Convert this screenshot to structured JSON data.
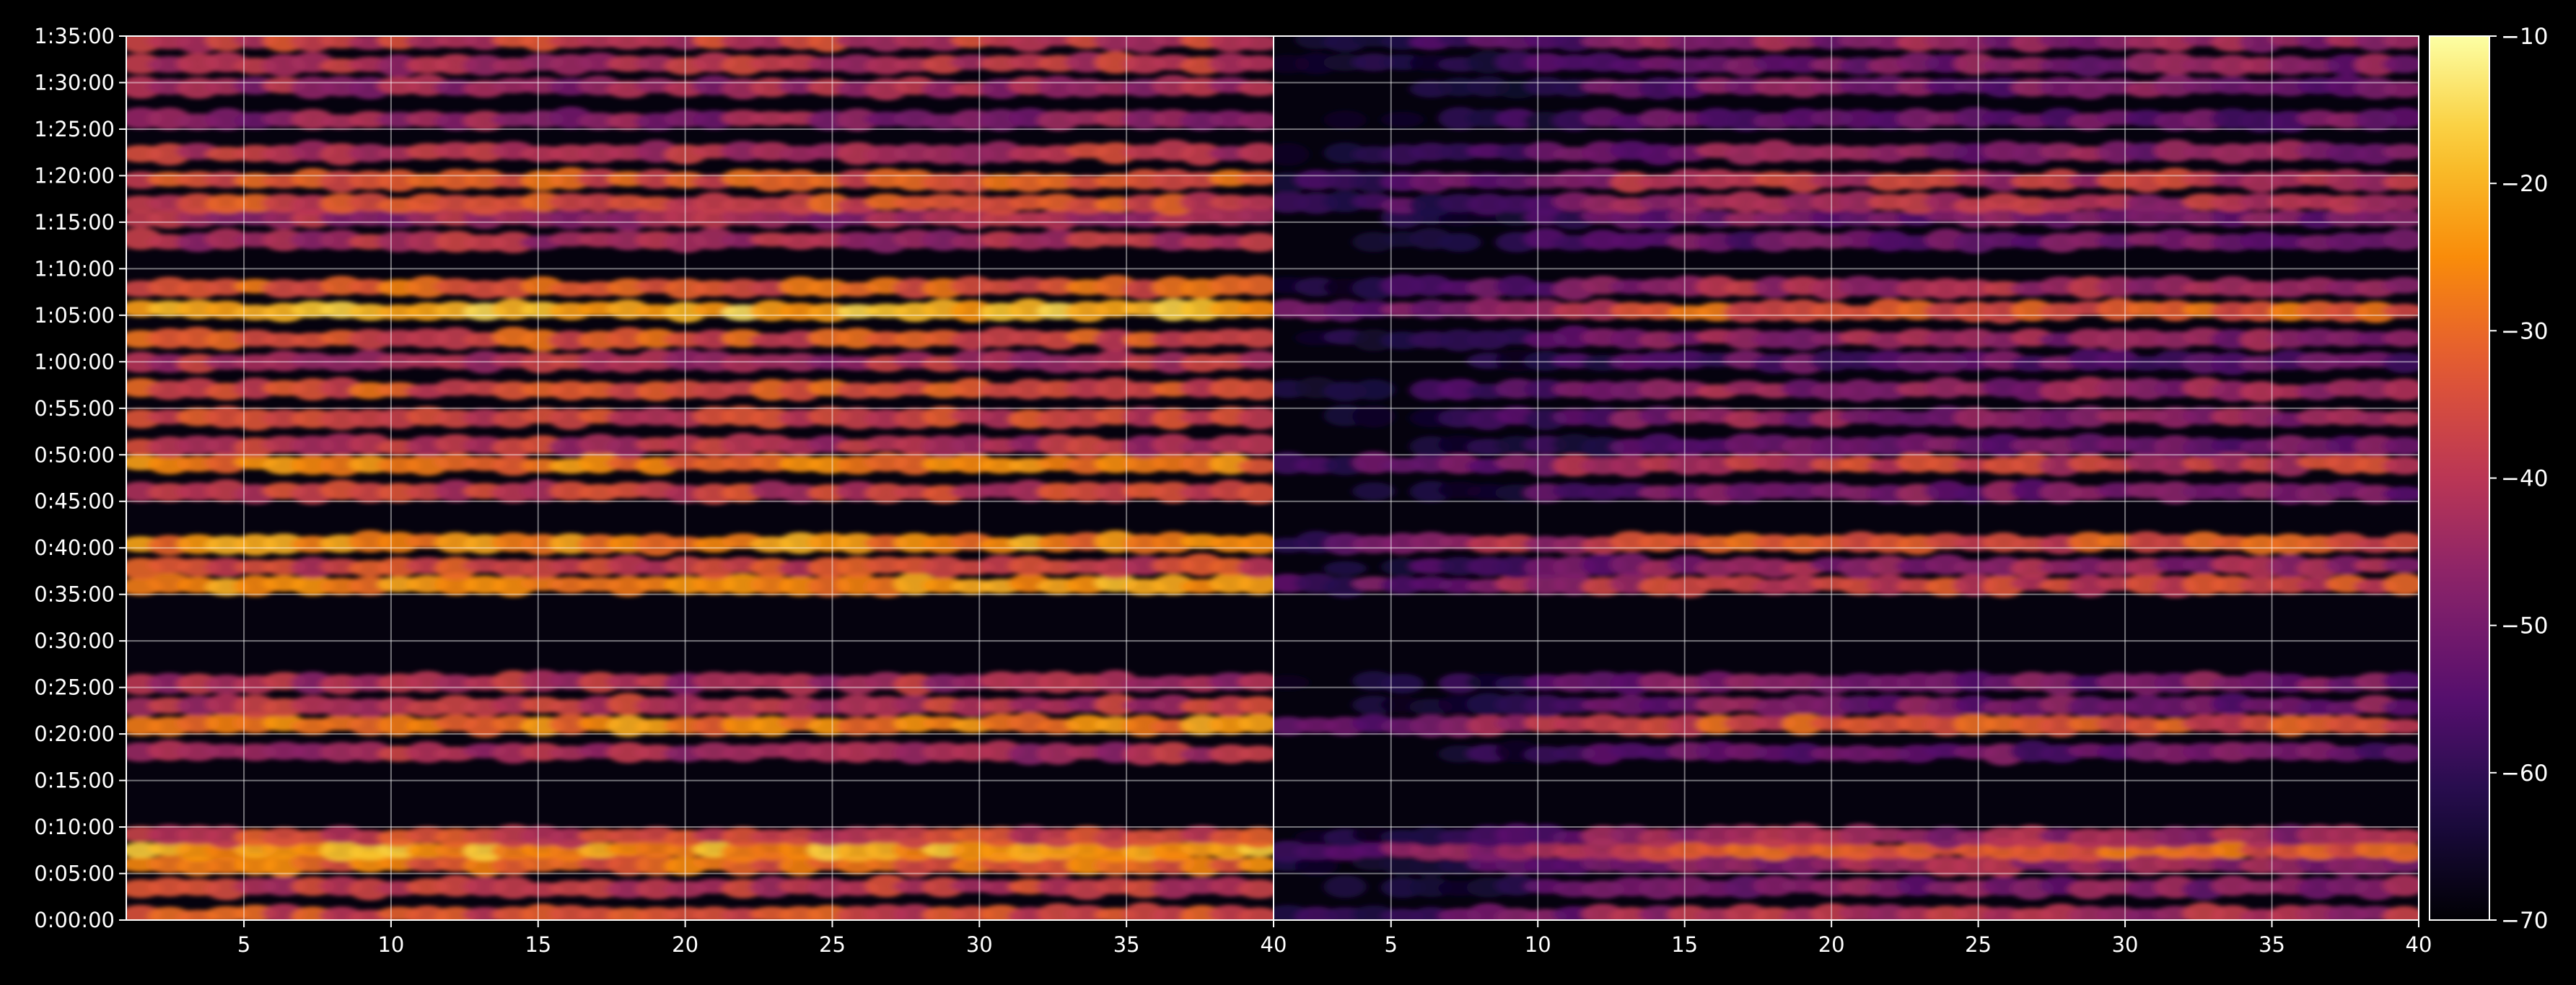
{
  "chart_data": {
    "type": "heatmap",
    "title": "",
    "xlabel": "",
    "ylabel": "",
    "panels": [
      {
        "name": "left",
        "xlim": [
          1,
          40
        ],
        "x_ticks": [
          5,
          10,
          15,
          20,
          25,
          30,
          35,
          40
        ]
      },
      {
        "name": "right",
        "xlim": [
          1,
          40
        ],
        "x_ticks": [
          5,
          10,
          15,
          20,
          25,
          30,
          35,
          40
        ]
      }
    ],
    "y_ticks": [
      "0:00:00",
      "0:05:00",
      "0:10:00",
      "0:15:00",
      "0:20:00",
      "0:25:00",
      "0:30:00",
      "0:35:00",
      "0:40:00",
      "0:45:00",
      "0:50:00",
      "0:55:00",
      "1:00:00",
      "1:05:00",
      "1:10:00",
      "1:15:00",
      "1:20:00",
      "1:25:00",
      "1:30:00",
      "1:35:00"
    ],
    "ylim_seconds": [
      0,
      5700
    ],
    "grid": true,
    "colormap": "inferno",
    "colorbar": {
      "ticks": [
        -10,
        -20,
        -30,
        -40,
        -50,
        -60,
        -70
      ],
      "range": [
        -70,
        -10
      ]
    },
    "band_levels_db": [
      {
        "t": "0:00:30",
        "left": -35,
        "right": -42
      },
      {
        "t": "0:03:30",
        "left": -38,
        "right": -48
      },
      {
        "t": "0:06:00",
        "left": -30,
        "right": -45
      },
      {
        "t": "0:07:30",
        "left": -22,
        "right": -32
      },
      {
        "t": "0:09:00",
        "left": -36,
        "right": -44
      },
      {
        "t": "0:18:00",
        "left": -42,
        "right": -52
      },
      {
        "t": "0:21:00",
        "left": -26,
        "right": -34
      },
      {
        "t": "0:23:00",
        "left": -40,
        "right": -50
      },
      {
        "t": "0:25:30",
        "left": -42,
        "right": -50
      },
      {
        "t": "0:36:00",
        "left": -24,
        "right": -36
      },
      {
        "t": "0:38:00",
        "left": -36,
        "right": -46
      },
      {
        "t": "0:40:30",
        "left": -25,
        "right": -34
      },
      {
        "t": "0:46:00",
        "left": -38,
        "right": -50
      },
      {
        "t": "0:49:00",
        "left": -27,
        "right": -38
      },
      {
        "t": "0:51:00",
        "left": -40,
        "right": -52
      },
      {
        "t": "0:54:00",
        "left": -36,
        "right": -47
      },
      {
        "t": "0:57:00",
        "left": -34,
        "right": -46
      },
      {
        "t": "1:00:00",
        "left": -42,
        "right": -54
      },
      {
        "t": "1:02:30",
        "left": -34,
        "right": -46
      },
      {
        "t": "1:05:30",
        "left": -20,
        "right": -32
      },
      {
        "t": "1:08:00",
        "left": -32,
        "right": -42
      },
      {
        "t": "1:13:00",
        "left": -42,
        "right": -52
      },
      {
        "t": "1:15:30",
        "left": -44,
        "right": -50
      },
      {
        "t": "1:17:00",
        "left": -35,
        "right": -42
      },
      {
        "t": "1:19:30",
        "left": -33,
        "right": -40
      },
      {
        "t": "1:22:30",
        "left": -40,
        "right": -48
      },
      {
        "t": "1:26:00",
        "left": -46,
        "right": -52
      },
      {
        "t": "1:29:30",
        "left": -44,
        "right": -50
      },
      {
        "t": "1:32:00",
        "left": -40,
        "right": -48
      },
      {
        "t": "1:34:30",
        "left": -38,
        "right": -46
      }
    ]
  }
}
